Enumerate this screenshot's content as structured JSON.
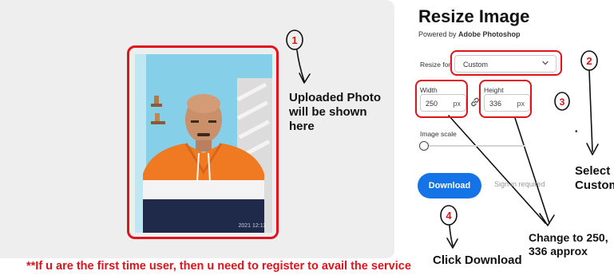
{
  "preview": {
    "photo_timestamp": "2021 12:11"
  },
  "annotations": {
    "step1": "1",
    "step2": "2",
    "step3": "3",
    "step4": "4",
    "uploaded_note": "Uploaded Photo will be shown here",
    "select_note": "Select Custom",
    "change_note": "Change to 250, 336 approx",
    "click_note": "Click Download",
    "warning": "**If u are the first time user, then u need to register to avail the service",
    "highlight_color": "#e0131c"
  },
  "app": {
    "title": "Resize Image",
    "powered_prefix": "Powered by",
    "powered_brand": "Adobe Photoshop"
  },
  "form": {
    "resize_for_label": "Resize for:",
    "resize_for_value": "Custom",
    "width_label": "Width",
    "width_value": "250",
    "height_label": "Height",
    "height_value": "336",
    "unit": "px",
    "image_scale_label": "Image scale",
    "image_scale_value": 0,
    "scale_dot": "•"
  },
  "actions": {
    "download_label": "Download",
    "download_color": "#1473e6",
    "sign_in_label": "Sign-in required"
  },
  "icons": {
    "dropdown": "chevron-down-icon",
    "link": "link-icon"
  }
}
